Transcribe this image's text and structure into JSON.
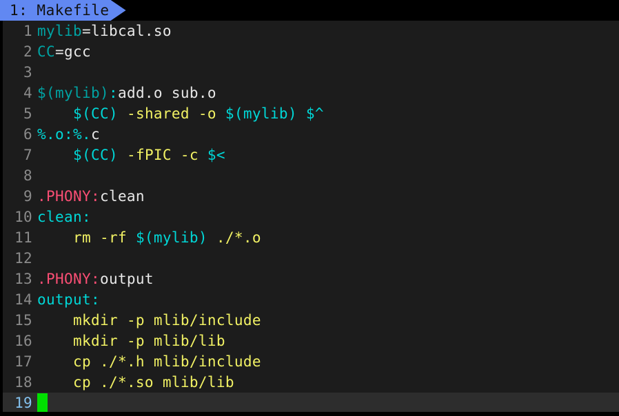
{
  "window": {
    "editor_name": "vim",
    "background": "#1c1c1c",
    "tabline_background": "#000000"
  },
  "tabline": {
    "active_tab": {
      "label": "1: Makefile",
      "index": "1",
      "filename": "Makefile",
      "background": "#6188f2",
      "text_color": "#111111"
    }
  },
  "colors": {
    "variable": "#00a3a3",
    "target": "#00d7d7",
    "plain_text": "#e8e8e8",
    "command": "#f2f264",
    "directive": "#fa4e74",
    "line_number": "#8a8a8a",
    "current_line_number": "#84c2ef",
    "current_line_bg": "#2d2d2d",
    "cursor": "#00e000"
  },
  "cursor": {
    "line": 19,
    "column": 1,
    "shape": "block"
  },
  "buffer": {
    "filename": "Makefile",
    "total_lines": 19,
    "lines": [
      {
        "number": "1",
        "tokens": [
          {
            "text": "mylib",
            "type": "variable"
          },
          {
            "text": "=libcal.so",
            "type": "plain"
          }
        ]
      },
      {
        "number": "2",
        "tokens": [
          {
            "text": "CC",
            "type": "variable"
          },
          {
            "text": "=gcc",
            "type": "plain"
          }
        ]
      },
      {
        "number": "3",
        "tokens": []
      },
      {
        "number": "4",
        "tokens": [
          {
            "text": "$(mylib)",
            "type": "variable"
          },
          {
            "text": ":",
            "type": "target"
          },
          {
            "text": "add.o sub.o",
            "type": "plain"
          }
        ]
      },
      {
        "number": "5",
        "tokens": [
          {
            "text": "    ",
            "type": "plain"
          },
          {
            "text": "$(CC)",
            "type": "target"
          },
          {
            "text": " ",
            "type": "plain"
          },
          {
            "text": "-shared -o ",
            "type": "command"
          },
          {
            "text": "$(mylib)",
            "type": "target"
          },
          {
            "text": " ",
            "type": "plain"
          },
          {
            "text": "$^",
            "type": "target"
          }
        ]
      },
      {
        "number": "6",
        "tokens": [
          {
            "text": "%.o:%.",
            "type": "target"
          },
          {
            "text": "c",
            "type": "plain"
          }
        ]
      },
      {
        "number": "7",
        "tokens": [
          {
            "text": "    ",
            "type": "plain"
          },
          {
            "text": "$(CC)",
            "type": "target"
          },
          {
            "text": " ",
            "type": "plain"
          },
          {
            "text": "-fPIC -c ",
            "type": "command"
          },
          {
            "text": "$<",
            "type": "target"
          }
        ]
      },
      {
        "number": "8",
        "tokens": []
      },
      {
        "number": "9",
        "tokens": [
          {
            "text": ".PHONY:",
            "type": "directive"
          },
          {
            "text": "clean",
            "type": "plain"
          }
        ]
      },
      {
        "number": "10",
        "tokens": [
          {
            "text": "clean:",
            "type": "target"
          }
        ]
      },
      {
        "number": "11",
        "tokens": [
          {
            "text": "    ",
            "type": "plain"
          },
          {
            "text": "rm -rf ",
            "type": "command"
          },
          {
            "text": "$(mylib)",
            "type": "target"
          },
          {
            "text": " ",
            "type": "plain"
          },
          {
            "text": "./*.o",
            "type": "command"
          }
        ]
      },
      {
        "number": "12",
        "tokens": []
      },
      {
        "number": "13",
        "tokens": [
          {
            "text": ".PHONY:",
            "type": "directive"
          },
          {
            "text": "output",
            "type": "plain"
          }
        ]
      },
      {
        "number": "14",
        "tokens": [
          {
            "text": "output:",
            "type": "target"
          }
        ]
      },
      {
        "number": "15",
        "tokens": [
          {
            "text": "    ",
            "type": "plain"
          },
          {
            "text": "mkdir -p mlib/include",
            "type": "command"
          }
        ]
      },
      {
        "number": "16",
        "tokens": [
          {
            "text": "    ",
            "type": "plain"
          },
          {
            "text": "mkdir -p mlib/lib",
            "type": "command"
          }
        ]
      },
      {
        "number": "17",
        "tokens": [
          {
            "text": "    ",
            "type": "plain"
          },
          {
            "text": "cp ./*.h mlib/include",
            "type": "command"
          }
        ]
      },
      {
        "number": "18",
        "tokens": [
          {
            "text": "    ",
            "type": "plain"
          },
          {
            "text": "cp ./*.so mlib/lib",
            "type": "command"
          }
        ]
      },
      {
        "number": "19",
        "tokens": [],
        "current": true,
        "has_cursor": true
      }
    ]
  }
}
